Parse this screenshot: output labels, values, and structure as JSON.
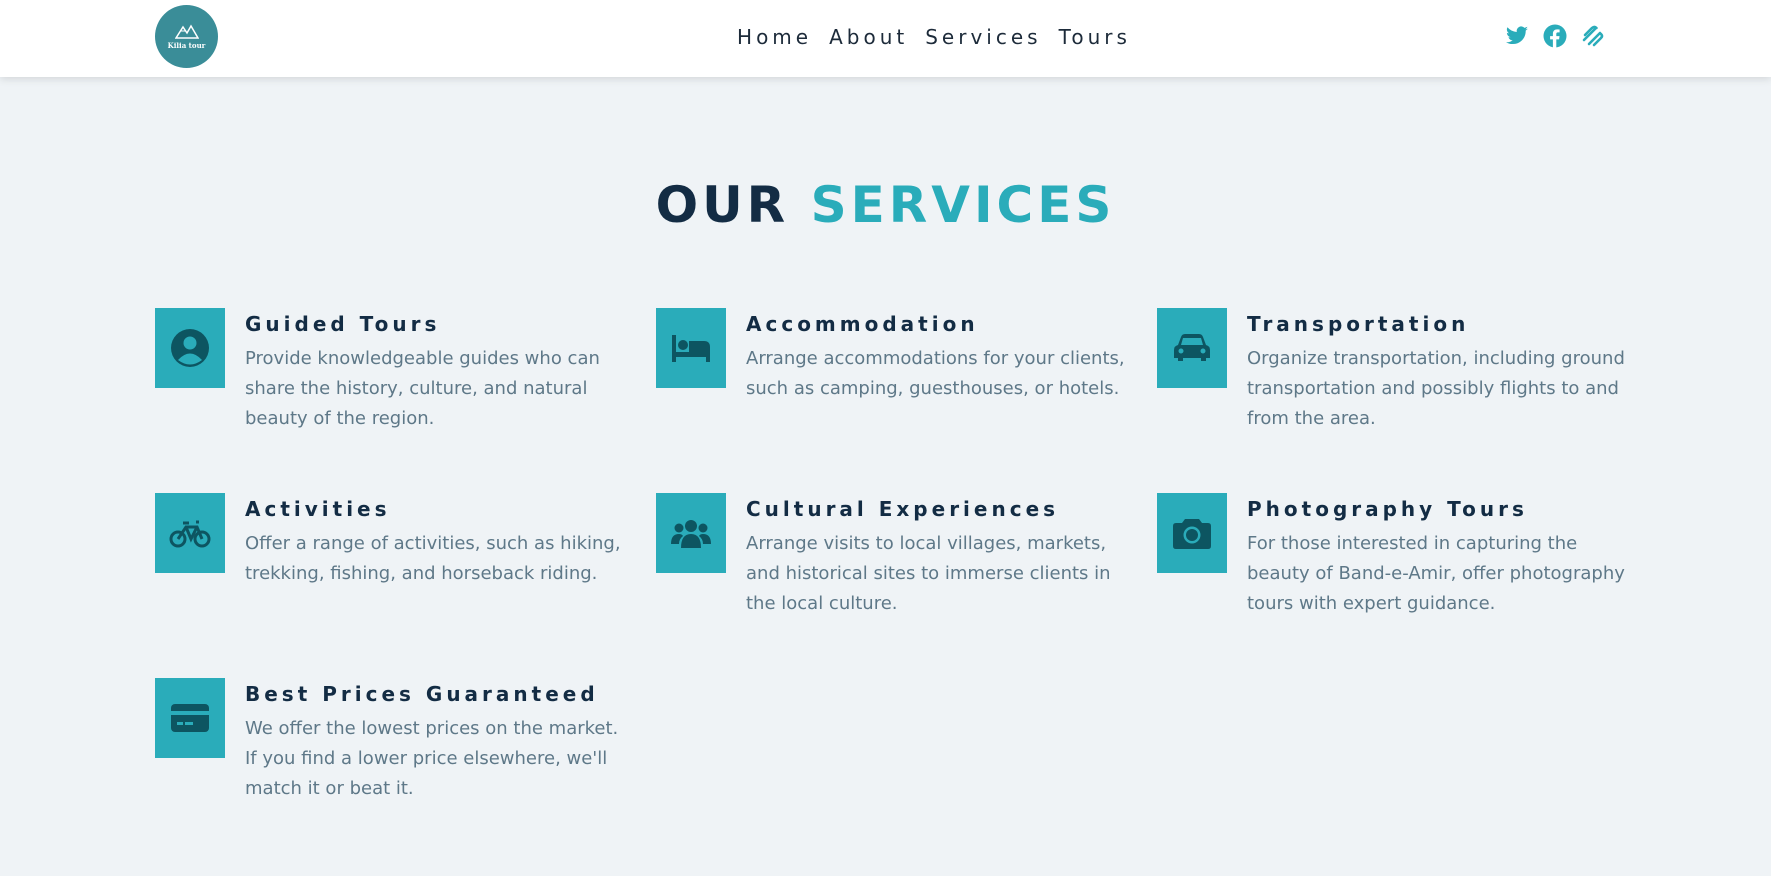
{
  "header": {
    "logo_text": "Kilia tour",
    "nav": [
      "Home",
      "About",
      "Services",
      "Tours"
    ],
    "social": [
      "twitter-icon",
      "facebook-icon",
      "squarespace-icon"
    ]
  },
  "section": {
    "title_part1": "OUR",
    "title_part2": "SERVICES"
  },
  "services": [
    {
      "title": "Guided Tours",
      "desc": "Provide knowledgeable guides who can share the history, culture, and natural beauty of the region.",
      "icon": "user-circle-icon"
    },
    {
      "title": "Accommodation",
      "desc": "Arrange accommodations for your clients, such as camping, guesthouses, or hotels.",
      "icon": "bed-icon"
    },
    {
      "title": "Transportation",
      "desc": "Organize transportation, including ground transportation and possibly flights to and from the area.",
      "icon": "car-icon"
    },
    {
      "title": "Activities",
      "desc": "Offer a range of activities, such as hiking, trekking, fishing, and horseback riding.",
      "icon": "bicycle-icon"
    },
    {
      "title": "Cultural Experiences",
      "desc": "Arrange visits to local villages, markets, and historical sites to immerse clients in the local culture.",
      "icon": "people-group-icon"
    },
    {
      "title": "Photography Tours",
      "desc": "For those interested in capturing the beauty of Band-e-Amir, offer photography tours with expert guidance.",
      "icon": "camera-icon"
    },
    {
      "title": "Best Prices Guaranteed",
      "desc": "We offer the lowest prices on the market. If you find a lower price elsewhere, we'll match it or beat it.",
      "icon": "credit-card-icon"
    }
  ],
  "colors": {
    "accent": "#2aacba",
    "dark": "#132c44",
    "text_muted": "#5e7888",
    "icon_fill": "#0d5561",
    "background": "#eff3f6"
  }
}
